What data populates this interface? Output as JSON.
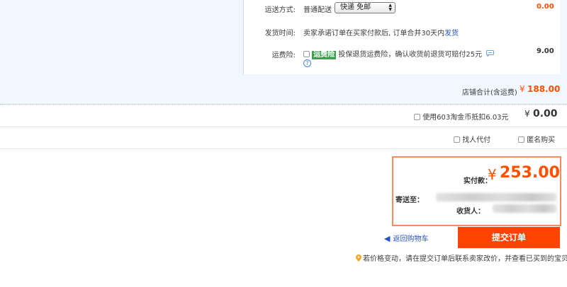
{
  "shipping": {
    "label": "运送方式:",
    "method": "普通配送",
    "select_value": "快递 免邮",
    "price": "0.00"
  },
  "delivery": {
    "label": "发货时间:",
    "text": "卖家承诺订单在买家付款后, 订单合并30天内",
    "link": "发货"
  },
  "insurance": {
    "label": "运费险:",
    "badge": "运费险",
    "text": "投保退货运费险，确认收货前退货可赔付25元",
    "price": "9.00",
    "help": "?"
  },
  "shop_total": {
    "label": "店铺合计(含运费)",
    "currency": "¥",
    "amount": "188.00"
  },
  "coins": {
    "label": "使用603淘金币抵扣6.03元",
    "currency": "¥",
    "amount": "0.00"
  },
  "options": {
    "proxy_pay": "找人代付",
    "anonymous": "匿名购买"
  },
  "payment": {
    "label": "实付款：",
    "currency": "¥",
    "amount": "253.00",
    "ship_to_label": "寄送至：",
    "receiver_label": "收货人："
  },
  "actions": {
    "back_to_cart": "返回购物车",
    "submit": "提交订单"
  },
  "notice": {
    "text": "若价格变动，请在提交订单后联系卖家改价，并查看已买到的宝贝"
  },
  "colors": {
    "accent": "#ff4400",
    "price": "#ff5000",
    "link": "#2553c7",
    "panel": "#f2f7ff",
    "badge": "#3aa24c"
  }
}
